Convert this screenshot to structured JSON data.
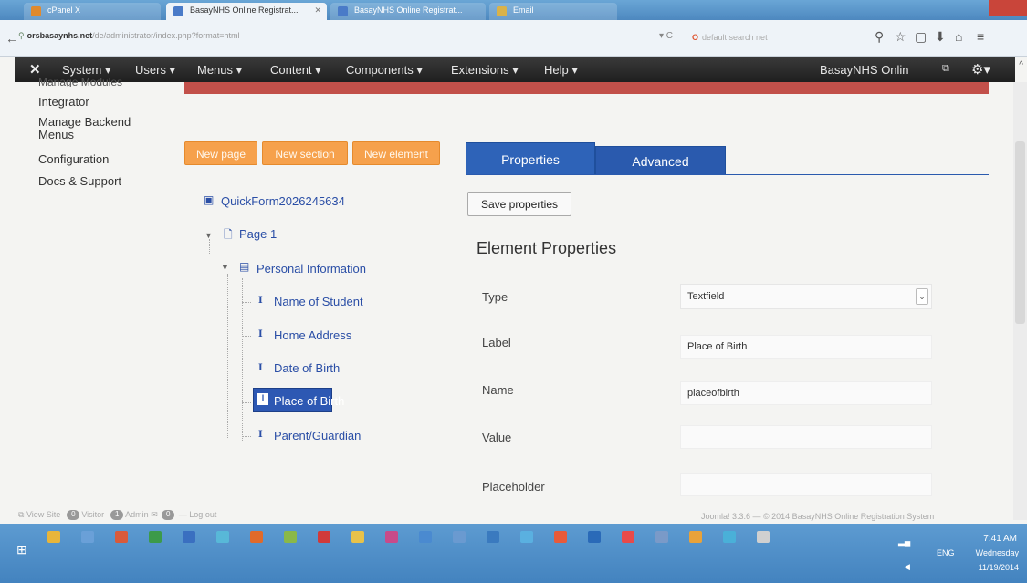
{
  "browser": {
    "tabs": [
      {
        "label": "cPanel X",
        "active": false,
        "icon_color": "#e08a2e"
      },
      {
        "label": "BasayNHS Online Registrat...",
        "active": true,
        "icon_color": "#4a7bc8"
      },
      {
        "label": "BasayNHS Online Registrat...",
        "active": false,
        "icon_color": "#4a7bc8"
      },
      {
        "label": "Email",
        "active": false,
        "icon_color": "#d9b24a"
      }
    ],
    "url_site": "orsbasaynhs.net",
    "url_path": "/de/administrator/index.php?format=html",
    "search_placeholder": "default search net"
  },
  "admin_nav": {
    "logo_icon": "joomla-icon",
    "menus": [
      "System ▾",
      "Users ▾",
      "Menus ▾",
      "Content ▾",
      "Components ▾",
      "Extensions ▾",
      "Help ▾"
    ],
    "site_name": "BasayNHS Onlin",
    "accent_red": "#c2504a"
  },
  "sidebar": {
    "partial_item": "Manage Modules",
    "items": [
      "Integrator",
      "Manage Backend Menus",
      "Configuration",
      "Docs & Support"
    ]
  },
  "builder_buttons": [
    "New page",
    "New section",
    "New element"
  ],
  "tree": {
    "form": "QuickForm2026245634",
    "page": "Page 1",
    "section": "Personal Information",
    "fields": [
      "Name of Student",
      "Home Address",
      "Date of Birth",
      "Place of Birth",
      "Parent/Guardian"
    ],
    "selected_field": "Place of Birth"
  },
  "properties": {
    "tabs": [
      "Properties",
      "Advanced"
    ],
    "active_tab": "Properties",
    "save_label": "Save properties",
    "title": "Element Properties",
    "rows": [
      {
        "label": "Type",
        "value": "Textfield",
        "kind": "select"
      },
      {
        "label": "Label",
        "value": "Place of Birth",
        "kind": "input"
      },
      {
        "label": "Name",
        "value": "placeofbirth",
        "kind": "input"
      },
      {
        "label": "Value",
        "value": "",
        "kind": "input"
      },
      {
        "label": "Placeholder",
        "value": "",
        "kind": "input"
      }
    ]
  },
  "status": {
    "view_site": "View Site",
    "visitor": "Visitor",
    "visitor_count": "0",
    "admin": "Admin",
    "admin_count": "1",
    "messages_count": "0",
    "logout": "Log out",
    "footer": "Joomla! 3.3.6 — © 2014 BasayNHS Online Registration System"
  },
  "taskbar": {
    "language": "ENG",
    "time": "7:41 AM",
    "day": "Wednesday",
    "date": "11/19/2014",
    "app_colors": [
      "#e8b53a",
      "#6aa0d8",
      "#d95a3a",
      "#3c9a4a",
      "#3a6fc0",
      "#58b8d8",
      "#e06a2a",
      "#8ab848",
      "#d03a3a",
      "#e8c24a",
      "#c84a8a",
      "#4a8ad0",
      "#6a9ad0",
      "#3a7abf",
      "#5ab0e0",
      "#e85a3a",
      "#2a6ab8",
      "#e84a4a",
      "#7a9ac8",
      "#e8a23a",
      "#4ab0d8",
      "#d0d0d0"
    ]
  }
}
